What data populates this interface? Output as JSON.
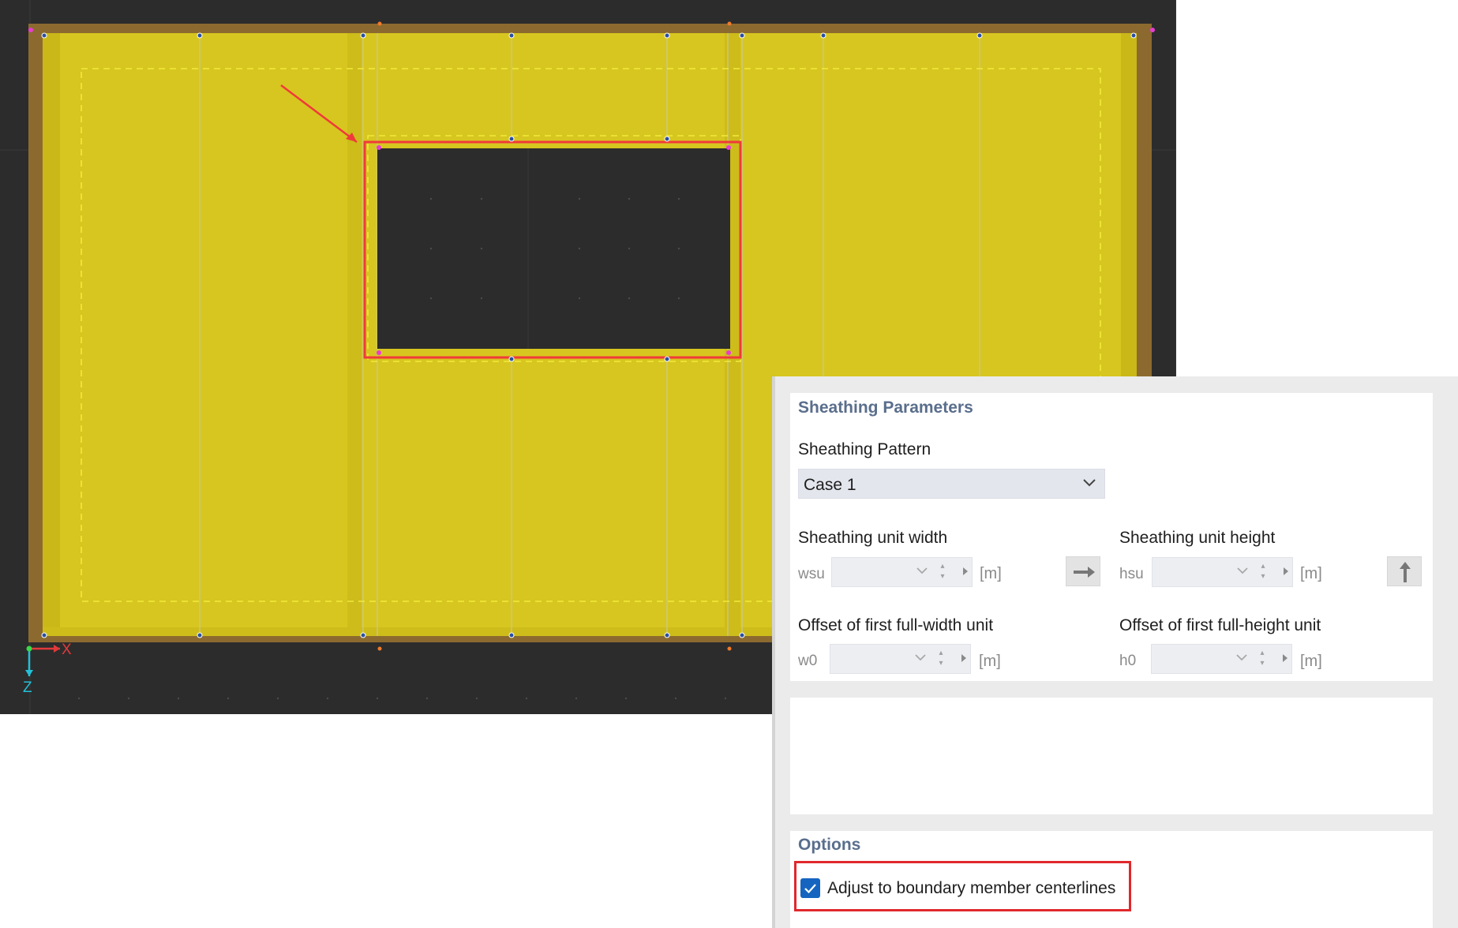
{
  "viewport": {
    "axes": {
      "x_label": "X",
      "z_label": "Z"
    },
    "colors": {
      "background": "#2c2c2c",
      "sheathing": "#d7c61f",
      "frame": "#8c6a2f",
      "highlight": "#f03a3a"
    }
  },
  "panel": {
    "params": {
      "title": "Sheathing Parameters",
      "pattern_label": "Sheathing Pattern",
      "pattern_value": "Case 1",
      "unit_width_label": "Sheathing unit width",
      "unit_width_symbol": "wsu",
      "unit_width_unit": "[m]",
      "unit_height_label": "Sheathing unit height",
      "unit_height_symbol": "hsu",
      "unit_height_unit": "[m]",
      "offset_width_label": "Offset of first full-width unit",
      "offset_width_symbol": "w0",
      "offset_width_unit": "[m]",
      "offset_height_label": "Offset of first full-height unit",
      "offset_height_symbol": "h0",
      "offset_height_unit": "[m]"
    },
    "options": {
      "title": "Options",
      "adjust_label": "Adjust to boundary member centerlines",
      "adjust_checked": true
    }
  }
}
